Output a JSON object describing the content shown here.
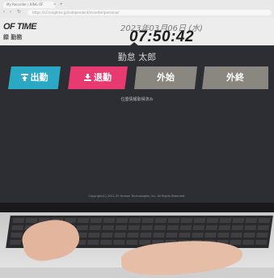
{
  "browser": {
    "tab_title": "My Recorder | KING OF",
    "tab_close": "×",
    "new_tab": "+",
    "url": "https://s2.kingtime.jp/independent/recorder/personal/",
    "back_icon": "arrow-left-icon",
    "forward_icon": "arrow-right-icon",
    "reload_icon": "reload-icon"
  },
  "header": {
    "logo_main": "OF TIME",
    "logo_sub": "録 勤務",
    "date": "2023年03月06日 (水)",
    "time": "07:50:42"
  },
  "user": {
    "name": "勤怠 太郎"
  },
  "buttons": {
    "clock_in": "出勤",
    "clock_out": "退勤",
    "go_out": "外始",
    "go_back": "外終"
  },
  "status": {
    "message": "位置情報取得済み"
  },
  "footer": {
    "copyright": "Copyright(C) 2021-25 Human Technologies, Inc. All Rights Reserved."
  },
  "colors": {
    "clock_in": "#2aa8c4",
    "clock_out": "#e63a71",
    "go": "#8a8680",
    "panel": "#2d2e33"
  }
}
